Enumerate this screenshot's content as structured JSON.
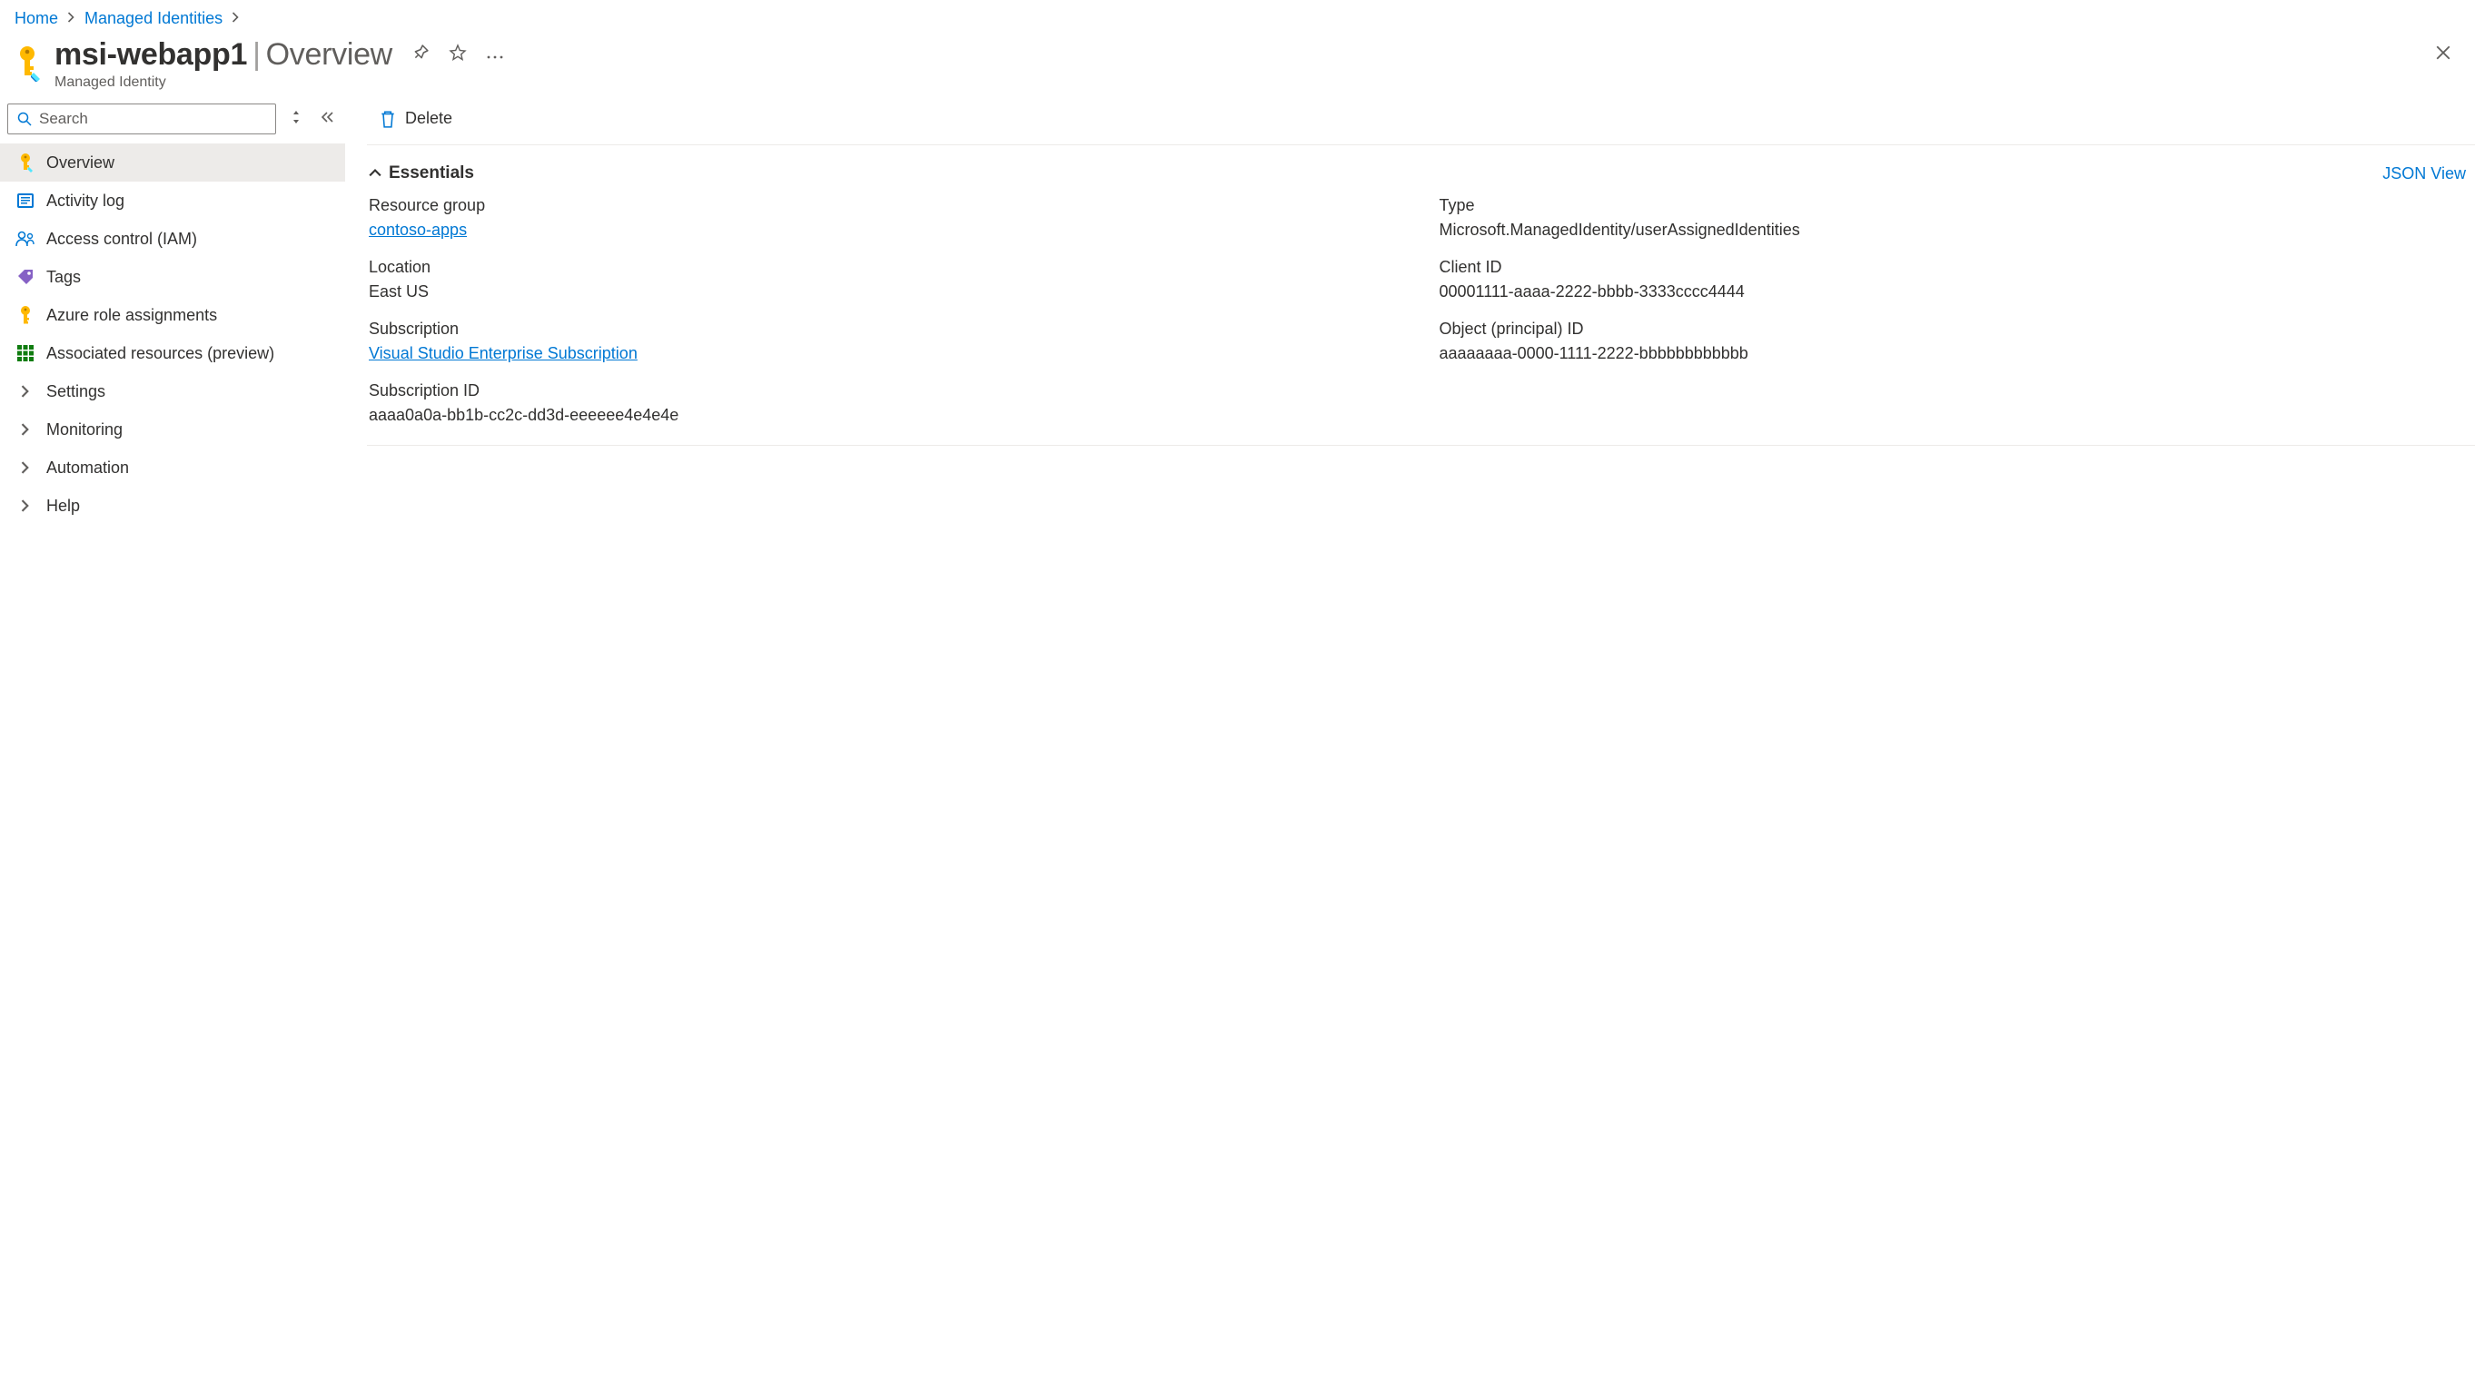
{
  "breadcrumb": {
    "home": "Home",
    "parent": "Managed Identities"
  },
  "header": {
    "resource_name": "msi-webapp1",
    "section": "Overview",
    "subtitle": "Managed Identity"
  },
  "sidebar": {
    "search_placeholder": "Search",
    "items": [
      {
        "label": "Overview",
        "icon": "key-icon",
        "selected": true
      },
      {
        "label": "Activity log",
        "icon": "log-icon"
      },
      {
        "label": "Access control (IAM)",
        "icon": "people-icon"
      },
      {
        "label": "Tags",
        "icon": "tag-icon"
      },
      {
        "label": "Azure role assignments",
        "icon": "key-icon"
      },
      {
        "label": "Associated resources (preview)",
        "icon": "grid-icon"
      },
      {
        "label": "Settings",
        "icon": "chevron-right-icon",
        "expandable": true
      },
      {
        "label": "Monitoring",
        "icon": "chevron-right-icon",
        "expandable": true
      },
      {
        "label": "Automation",
        "icon": "chevron-right-icon",
        "expandable": true
      },
      {
        "label": "Help",
        "icon": "chevron-right-icon",
        "expandable": true
      }
    ]
  },
  "toolbar": {
    "delete_label": "Delete"
  },
  "essentials": {
    "title": "Essentials",
    "json_view_label": "JSON View",
    "fields": {
      "resource_group_label": "Resource group",
      "resource_group_value": "contoso-apps",
      "location_label": "Location",
      "location_value": "East US",
      "subscription_label": "Subscription",
      "subscription_value": "Visual Studio Enterprise Subscription",
      "subscription_id_label": "Subscription ID",
      "subscription_id_value": "aaaa0a0a-bb1b-cc2c-dd3d-eeeeee4e4e4e",
      "type_label": "Type",
      "type_value": "Microsoft.ManagedIdentity/userAssignedIdentities",
      "client_id_label": "Client ID",
      "client_id_value": "00001111-aaaa-2222-bbbb-3333cccc4444",
      "object_id_label": "Object (principal) ID",
      "object_id_value": "aaaaaaaa-0000-1111-2222-bbbbbbbbbbbb"
    }
  },
  "colors": {
    "link": "#0078d4",
    "key_yellow": "#ffb900",
    "tag_purple": "#8661c5",
    "grid_green": "#107c10",
    "log_blue": "#0078d4"
  }
}
